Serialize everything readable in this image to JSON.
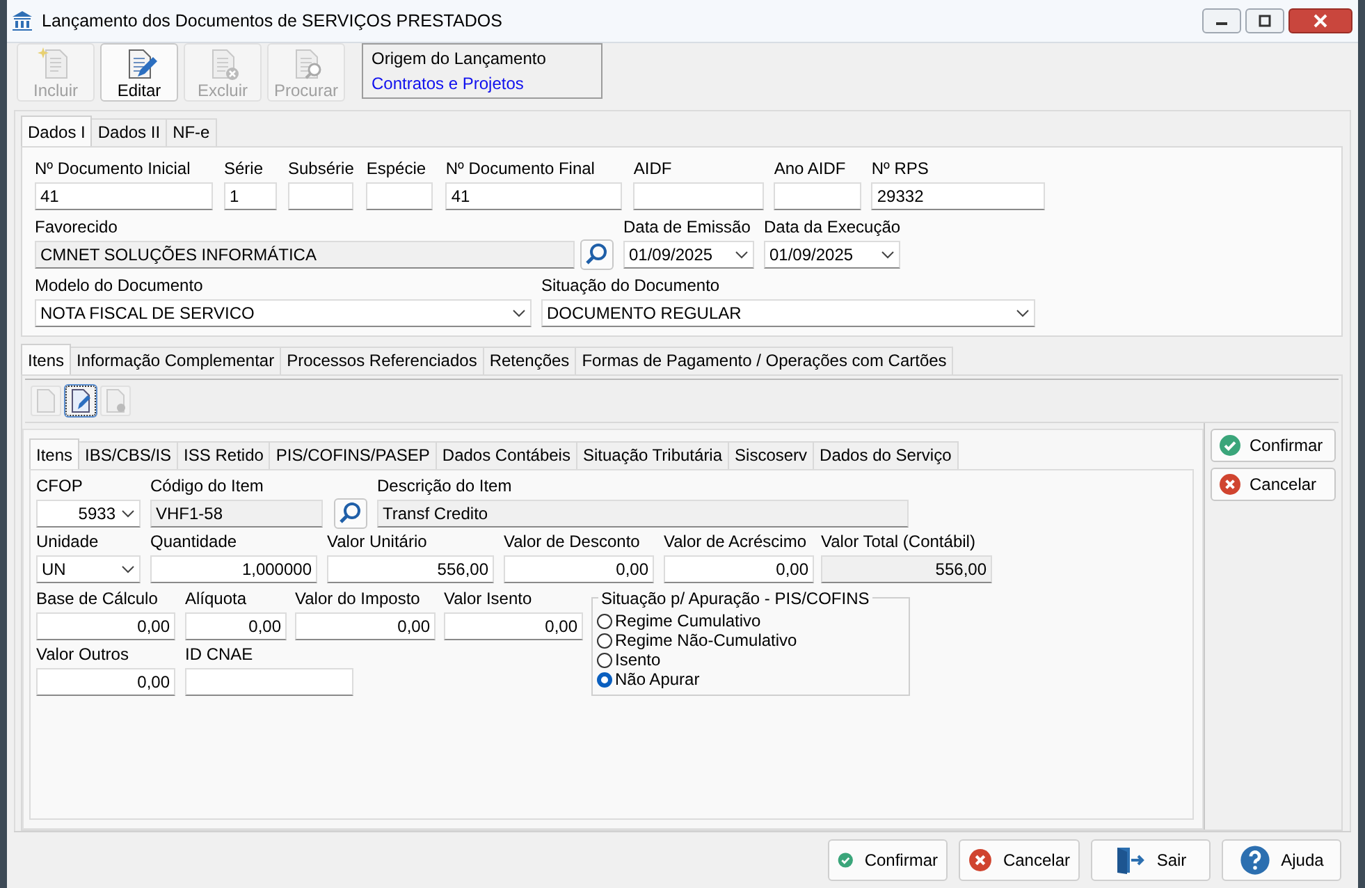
{
  "window": {
    "title": "Lançamento dos Documentos de SERVIÇOS PRESTADOS"
  },
  "toolbar": [
    {
      "label": "Incluir",
      "kind": "new",
      "disabled": true
    },
    {
      "label": "Editar",
      "kind": "edit",
      "disabled": false
    },
    {
      "label": "Excluir",
      "kind": "delete",
      "disabled": true
    },
    {
      "label": "Procurar",
      "kind": "find",
      "disabled": true
    }
  ],
  "origin": {
    "label": "Origem do Lançamento",
    "value": "Contratos e Projetos"
  },
  "header_tabs": [
    {
      "label": "Dados I",
      "selected": true
    },
    {
      "label": "Dados II",
      "selected": false
    },
    {
      "label": "NF-e",
      "selected": false
    }
  ],
  "header_rows": [
    [
      {
        "label": "Nº Documento Inicial",
        "value": "41",
        "kind": "text"
      },
      {
        "label": "Série",
        "value": "1",
        "kind": "text"
      },
      {
        "label": "Subsérie",
        "kind": "text"
      },
      {
        "label": "Espécie",
        "kind": "text"
      },
      {
        "label": "Nº Documento Final",
        "value": "41",
        "kind": "text"
      },
      {
        "label": "AIDF",
        "kind": "text"
      },
      {
        "label": "Ano AIDF",
        "kind": "text"
      },
      {
        "label": "Nº RPS",
        "value": "29332",
        "kind": "text"
      }
    ],
    [
      {
        "label": "Favorecido",
        "value": "CMNET SOLUÇÕES INFORMÁTICA",
        "kind": "readonly"
      },
      {
        "kind": "lookup"
      },
      {
        "label": "Data de Emissão",
        "value": "01/09/2025",
        "kind": "select"
      },
      {
        "label": "Data da Execução",
        "value": "01/09/2025",
        "kind": "select"
      }
    ],
    [
      {
        "label": "Modelo do Documento",
        "value": "NOTA FISCAL DE SERVICO",
        "kind": "select"
      },
      {
        "label": "Situação do Documento",
        "value": "DOCUMENTO REGULAR",
        "kind": "select"
      }
    ]
  ],
  "detail_tabs": [
    {
      "label": "Itens",
      "selected": true
    },
    {
      "label": "Informação Complementar",
      "selected": false
    },
    {
      "label": "Processos Referenciados",
      "selected": false
    },
    {
      "label": "Retenções",
      "selected": false
    },
    {
      "label": "Formas de Pagamento / Operações com Cartões",
      "selected": false
    }
  ],
  "item_toolbar": [
    {
      "kind": "new",
      "disabled": true
    },
    {
      "kind": "edit",
      "disabled": false
    },
    {
      "kind": "delete",
      "disabled": true
    }
  ],
  "item_tabs": [
    {
      "label": "Itens",
      "selected": true
    },
    {
      "label": "IBS/CBS/IS",
      "selected": false
    },
    {
      "label": "ISS Retido",
      "selected": false
    },
    {
      "label": "PIS/COFINS/PASEP",
      "selected": false
    },
    {
      "label": "Dados Contábeis",
      "selected": false
    },
    {
      "label": "Situação Tributária",
      "selected": false
    },
    {
      "label": "Siscoserv",
      "selected": false
    },
    {
      "label": "Dados do Serviço",
      "selected": false
    }
  ],
  "item_rows": [
    [
      {
        "label": "CFOP",
        "value": "5933",
        "kind": "select"
      },
      {
        "label": "Código do Item",
        "value": "VHF1-58",
        "kind": "readonly"
      },
      {
        "kind": "lookup"
      },
      {
        "label": "Descrição do Item",
        "value": "Transf Credito",
        "kind": "readonly"
      }
    ],
    [
      {
        "label": "Unidade",
        "value": "UN",
        "kind": "select"
      },
      {
        "label": "Quantidade",
        "value": "1,000000",
        "kind": "text"
      },
      {
        "label": "Valor Unitário",
        "value": "556,00",
        "kind": "text"
      },
      {
        "label": "Valor de Desconto",
        "value": "0,00",
        "kind": "text"
      },
      {
        "label": "Valor de Acréscimo",
        "value": "0,00",
        "kind": "text"
      },
      {
        "label": "Valor Total (Contábil)",
        "value": "556,00",
        "kind": "readonly"
      }
    ],
    [
      {
        "label": "Base de Cálculo",
        "value": "0,00",
        "kind": "text"
      },
      {
        "label": "Alíquota",
        "value": "0,00",
        "kind": "text"
      },
      {
        "label": "Valor do Imposto",
        "value": "0,00",
        "kind": "text"
      },
      {
        "label": "Valor Isento",
        "value": "0,00",
        "kind": "text"
      }
    ],
    [
      {
        "label": "Valor Outros",
        "value": "0,00",
        "kind": "text"
      },
      {
        "label": "ID CNAE",
        "kind": "text"
      }
    ]
  ],
  "apuracao": {
    "title": "Situação p/ Apuração - PIS/COFINS",
    "options": [
      {
        "label": "Regime Cumulativo",
        "selected": false
      },
      {
        "label": "Regime Não-Cumulativo",
        "selected": false
      },
      {
        "label": "Isento",
        "selected": false
      },
      {
        "label": "Não Apurar",
        "selected": true
      }
    ]
  },
  "side_buttons": [
    {
      "label": "Confirmar",
      "kind": "ok"
    },
    {
      "label": "Cancelar",
      "kind": "cancel"
    }
  ],
  "footer_buttons": [
    {
      "label": "Confirmar",
      "kind": "ok"
    },
    {
      "label": "Cancelar",
      "kind": "cancel"
    },
    {
      "label": "Sair",
      "kind": "exit"
    },
    {
      "label": "Ajuda",
      "kind": "help"
    }
  ]
}
